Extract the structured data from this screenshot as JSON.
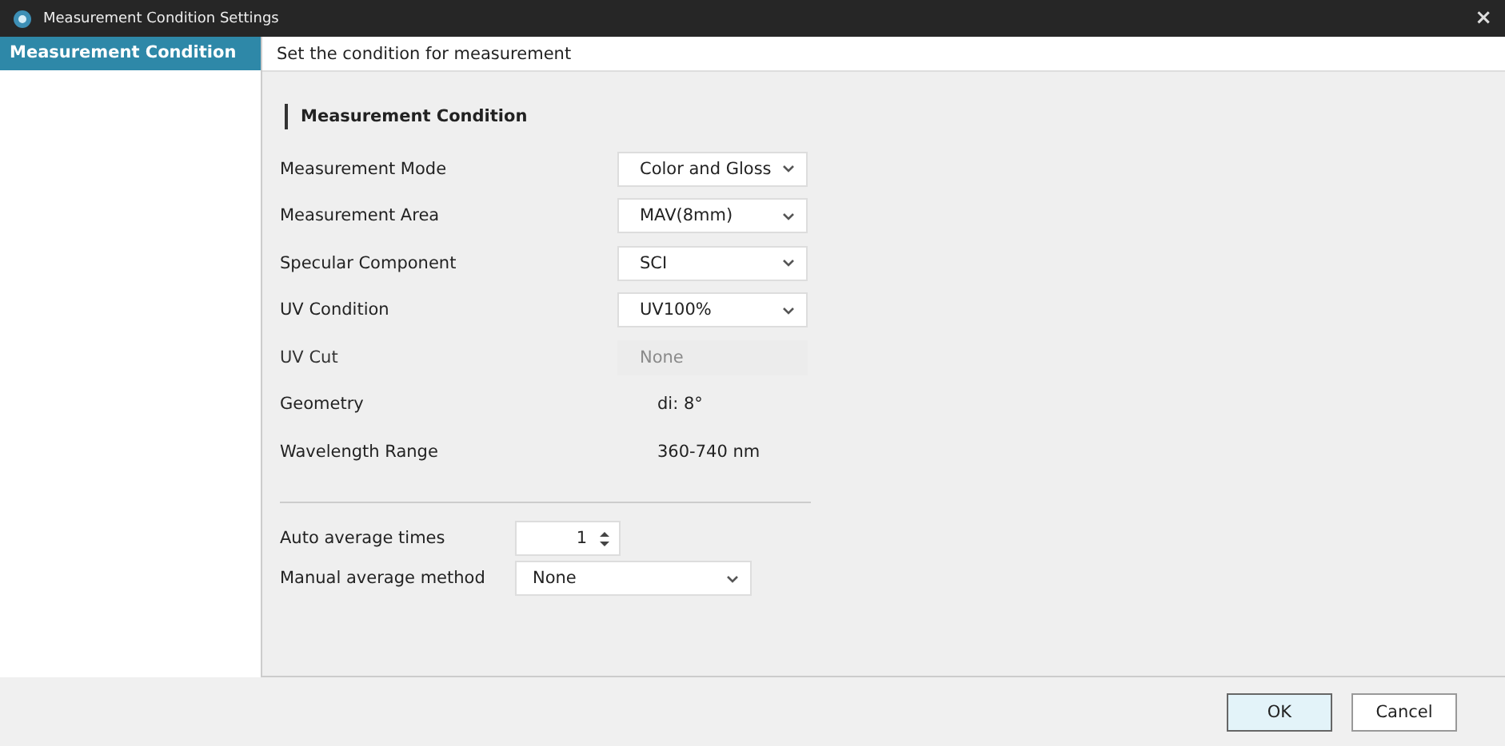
{
  "window": {
    "title": "Measurement Condition Settings",
    "close": "×"
  },
  "sidebar": {
    "items": [
      {
        "label": "Measurement Condition",
        "selected": true
      }
    ]
  },
  "header": "Set the condition for measurement",
  "section": {
    "title": "Measurement Condition",
    "rows": [
      {
        "kind": "select",
        "label": "Measurement Mode",
        "value": "Color and Gloss",
        "disabled": false
      },
      {
        "kind": "select",
        "label": "Measurement Area",
        "value": "MAV(8mm)",
        "disabled": false
      },
      {
        "kind": "select",
        "label": "Specular Component",
        "value": "SCI",
        "disabled": false
      },
      {
        "kind": "select",
        "label": "UV Condition",
        "value": "UV100%",
        "disabled": false
      },
      {
        "kind": "select",
        "label": "UV Cut",
        "value": "None",
        "disabled": true
      },
      {
        "kind": "text",
        "label": "Geometry",
        "value": "di: 8°"
      },
      {
        "kind": "text",
        "label": "Wavelength Range",
        "value": "360-740 nm"
      }
    ]
  },
  "averaging": [
    {
      "kind": "spin",
      "label": "Auto average times",
      "value": "1"
    },
    {
      "kind": "select",
      "label": "Manual average method",
      "value": "None"
    }
  ],
  "buttons": [
    {
      "label": "OK",
      "default": true
    },
    {
      "label": "Cancel",
      "default": false
    }
  ]
}
